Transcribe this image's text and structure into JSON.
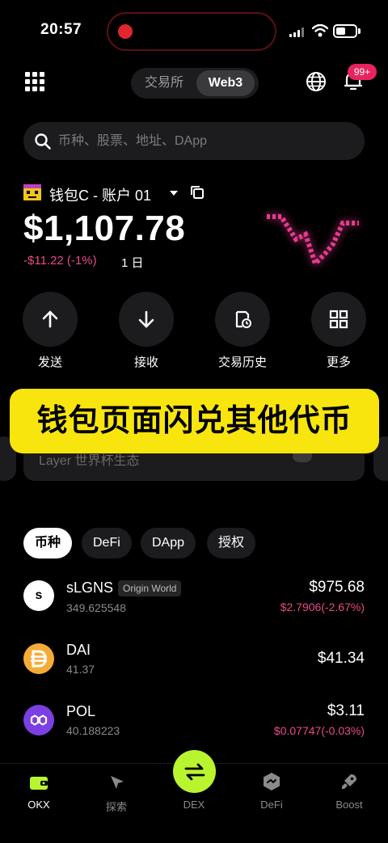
{
  "status_bar": {
    "time": "20:57"
  },
  "header": {
    "segment": {
      "exchange": "交易所",
      "web3": "Web3"
    },
    "notification_badge": "99+"
  },
  "search": {
    "placeholder": "币种、股票、地址、DApp"
  },
  "wallet": {
    "name": "钱包C - 账户 01",
    "balance": "$1,107.78",
    "change": "-$11.22 (-1%)",
    "period": "1 日"
  },
  "actions": {
    "send": "发送",
    "receive": "接收",
    "history": "交易历史",
    "more": "更多"
  },
  "banner": {
    "text": "Layer 世界杯生态"
  },
  "overlay": {
    "caption": "钱包页面闪兑其他代币"
  },
  "tabs": {
    "tokens": "币种",
    "defi": "DeFi",
    "dapp": "DApp",
    "auth": "授权"
  },
  "tokens": [
    {
      "symbol": "sLGNS",
      "tag": "Origin World",
      "amount": "349.625548",
      "value": "$975.68",
      "change": "$2.7906(-2.67%)",
      "logo_text": "s"
    },
    {
      "symbol": "DAI",
      "amount": "41.37",
      "value": "$41.34"
    },
    {
      "symbol": "POL",
      "amount": "40.188223",
      "value": "$3.11",
      "change": "$0.07747(-0.03%)"
    }
  ],
  "nav": {
    "okx": "OKX",
    "explore": "探索",
    "dex": "DEX",
    "defi": "DeFi",
    "boost": "Boost"
  },
  "colors": {
    "accent_lime": "#b8f52f",
    "negative_pink": "#e84a8a",
    "overlay_yellow": "#f9e50e",
    "badge_pink": "#e8245f"
  }
}
